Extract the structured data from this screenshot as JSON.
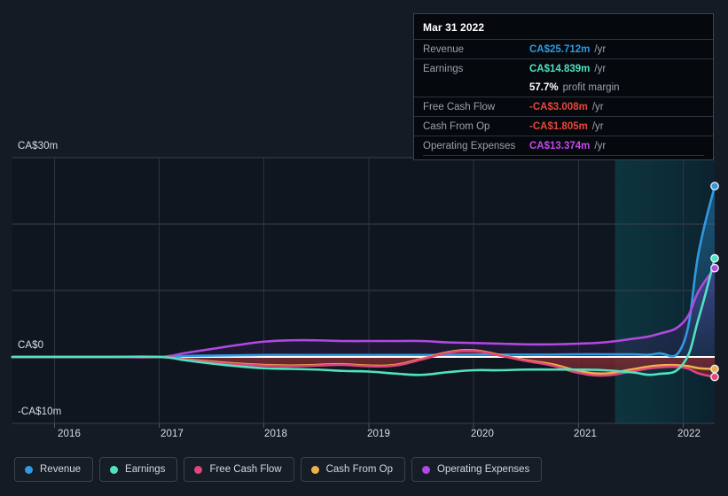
{
  "background_color": "#151b24",
  "tooltip": {
    "date": "Mar 31 2022",
    "rows": [
      {
        "label": "Revenue",
        "value": "CA$25.712m",
        "unit": "/yr",
        "color": "#2f9ae0"
      },
      {
        "label": "Earnings",
        "value": "CA$14.839m",
        "unit": "/yr",
        "color": "#4fe3c1"
      },
      {
        "label": "",
        "value": "57.7%",
        "unit": "profit margin",
        "color": "#ffffff"
      },
      {
        "label": "Free Cash Flow",
        "value": "-CA$3.008m",
        "unit": "/yr",
        "color": "#e8453c"
      },
      {
        "label": "Cash From Op",
        "value": "-CA$1.805m",
        "unit": "/yr",
        "color": "#e8453c"
      },
      {
        "label": "Operating Expenses",
        "value": "CA$13.374m",
        "unit": "/yr",
        "color": "#c44aee"
      }
    ]
  },
  "legend": {
    "items": [
      {
        "label": "Revenue",
        "color": "#2f9ae0"
      },
      {
        "label": "Earnings",
        "color": "#4fe3c1"
      },
      {
        "label": "Free Cash Flow",
        "color": "#e0457b"
      },
      {
        "label": "Cash From Op",
        "color": "#eeb14a"
      },
      {
        "label": "Operating Expenses",
        "color": "#b04ae0"
      }
    ]
  },
  "chart_data": {
    "type": "line",
    "title": "",
    "xlabel": "",
    "ylabel": "",
    "currency": "CA$",
    "grid": true,
    "legend_position": "bottom-left",
    "y_ticks": [
      {
        "label": "CA$30m",
        "value": 30
      },
      {
        "label": "CA$0",
        "value": 0
      },
      {
        "label": "-CA$10m",
        "value": -10
      }
    ],
    "ylim": [
      -10,
      30
    ],
    "x_ticks": [
      "2016",
      "2017",
      "2018",
      "2019",
      "2020",
      "2021",
      "2022"
    ],
    "xlim": [
      "2015.6",
      "2022.4"
    ],
    "forecast_region_start": "2021.35",
    "x": [
      2015.6,
      2016.0,
      2016.5,
      2017.0,
      2017.25,
      2017.5,
      2017.75,
      2018.0,
      2018.25,
      2018.5,
      2018.75,
      2019.0,
      2019.25,
      2019.5,
      2019.75,
      2020.0,
      2020.25,
      2020.5,
      2020.75,
      2021.0,
      2021.25,
      2021.5,
      2021.75,
      2022.0,
      2022.15,
      2022.3
    ],
    "series": [
      {
        "name": "Revenue",
        "color": "#2f9ae0",
        "values": [
          0,
          0,
          0,
          0,
          0.15,
          0.2,
          0.25,
          0.3,
          0.3,
          0.3,
          0.3,
          0.3,
          0.3,
          0.3,
          0.3,
          0.35,
          0.35,
          0.35,
          0.35,
          0.4,
          0.4,
          0.4,
          0.5,
          2.0,
          16.0,
          25.712
        ],
        "end_value": 25.712
      },
      {
        "name": "Earnings",
        "color": "#4fe3c1",
        "values": [
          0,
          0,
          0,
          0,
          -0.5,
          -1.0,
          -1.4,
          -1.7,
          -1.8,
          -1.9,
          -2.1,
          -2.2,
          -2.5,
          -2.7,
          -2.3,
          -2.0,
          -2.0,
          -1.9,
          -1.9,
          -1.9,
          -2.0,
          -2.3,
          -2.6,
          -1.0,
          6.0,
          14.839
        ],
        "end_value": 14.839
      },
      {
        "name": "Free Cash Flow",
        "color": "#e0457b",
        "values": [
          0,
          0,
          0,
          0,
          -0.4,
          -0.8,
          -1.1,
          -1.3,
          -1.4,
          -1.3,
          -1.2,
          -1.4,
          -1.3,
          -0.4,
          0.6,
          0.9,
          0.2,
          -0.6,
          -1.3,
          -2.4,
          -2.8,
          -2.2,
          -1.6,
          -1.6,
          -2.5,
          -3.008
        ],
        "end_value": -3.008
      },
      {
        "name": "Cash From Op",
        "color": "#eeb14a",
        "values": [
          0,
          0,
          0,
          0,
          -0.35,
          -0.7,
          -1.0,
          -1.2,
          -1.3,
          -1.2,
          -1.1,
          -1.3,
          -1.2,
          -0.3,
          0.7,
          1.0,
          0.3,
          -0.5,
          -1.1,
          -2.1,
          -2.5,
          -1.9,
          -1.3,
          -1.3,
          -1.7,
          -1.805
        ],
        "end_value": -1.805
      },
      {
        "name": "Operating Expenses",
        "color": "#b04ae0",
        "values": [
          0,
          0,
          0,
          0,
          0.6,
          1.2,
          1.8,
          2.3,
          2.5,
          2.5,
          2.4,
          2.4,
          2.4,
          2.4,
          2.2,
          2.1,
          2.0,
          1.9,
          1.9,
          2.0,
          2.2,
          2.7,
          3.4,
          5.2,
          10.0,
          13.374
        ],
        "end_value": 13.374
      }
    ]
  }
}
